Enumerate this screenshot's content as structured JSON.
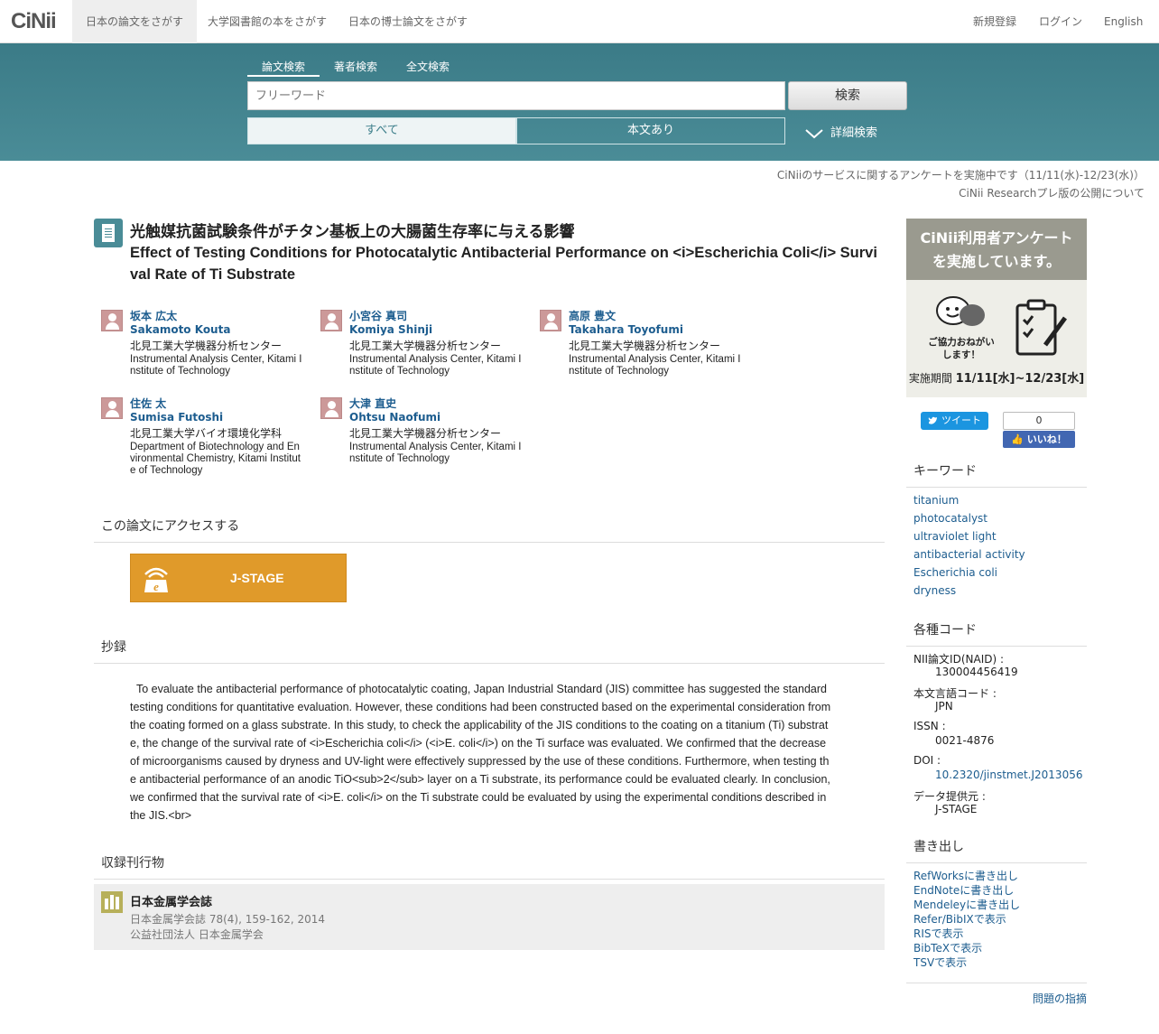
{
  "header": {
    "logo": "CiNii",
    "tabs": [
      "日本の論文をさがす",
      "大学図書館の本をさがす",
      "日本の博士論文をさがす"
    ],
    "right": [
      "新規登録",
      "ログイン",
      "English"
    ]
  },
  "search": {
    "tabs": [
      "論文検索",
      "著者検索",
      "全文検索"
    ],
    "placeholder": "フリーワード",
    "button": "検索",
    "filters": [
      "すべて",
      "本文あり"
    ],
    "advanced": "詳細検索"
  },
  "notices": [
    "CiNiiのサービスに関するアンケートを実施中です（11/11(水)-12/23(水)）",
    "CiNii Researchプレ版の公開について"
  ],
  "paper": {
    "title_ja": "光触媒抗菌試験条件がチタン基板上の大腸菌生存率に与える影響",
    "title_en": "Effect of Testing Conditions for Photocatalytic Antibacterial Performance on <i>Escherichia Coli</i> Survival Rate of Ti Substrate"
  },
  "authors": [
    {
      "ja": "坂本 広太",
      "en": "Sakamoto Kouta",
      "aff_ja": "北見工業大学機器分析センター",
      "aff_en": "Instrumental Analysis Center, Kitami Institute of Technology"
    },
    {
      "ja": "小宮谷 真司",
      "en": "Komiya Shinji",
      "aff_ja": "北見工業大学機器分析センター",
      "aff_en": "Instrumental Analysis Center, Kitami Institute of Technology"
    },
    {
      "ja": "高原 豊文",
      "en": "Takahara Toyofumi",
      "aff_ja": "北見工業大学機器分析センター",
      "aff_en": "Instrumental Analysis Center, Kitami Institute of Technology"
    },
    {
      "ja": "住佐 太",
      "en": "Sumisa Futoshi",
      "aff_ja": "北見工業大学バイオ環境化学科",
      "aff_en": "Department of Biotechnology and Environmental Chemistry, Kitami Institute of Technology"
    },
    {
      "ja": "大津 直史",
      "en": "Ohtsu Naofumi",
      "aff_ja": "北見工業大学機器分析センター",
      "aff_en": "Instrumental Analysis Center, Kitami Institute of Technology"
    }
  ],
  "access": {
    "heading": "この論文にアクセスする",
    "button": "J-STAGE"
  },
  "abstract": {
    "heading": "抄録",
    "text": "To evaluate the antibacterial performance of photocatalytic coating, Japan Industrial Standard (JIS) committee has suggested the standard testing conditions for quantitative evaluation. However, these conditions had been constructed based on the experimental consideration from the coating formed on a glass substrate. In this study, to check the applicability of the JIS conditions to the coating on a titanium (Ti) substrate, the change of the survival rate of <i>Escherichia coli</i> (<i>E. coli</i>) on the Ti surface was evaluated. We confirmed that the decrease of microorganisms caused by dryness and UV-light were effectively suppressed by the use of these conditions. Furthermore, when testing the antibacterial performance of an anodic TiO<sub>2</sub> layer on a Ti substrate, its performance could be evaluated clearly. In conclusion, we confirmed that the survival rate of <i>E. coli</i> on the Ti substrate could be evaluated by using the experimental conditions described in the JIS.<br>"
  },
  "journal": {
    "heading": "収録刊行物",
    "title": "日本金属学会誌",
    "citation": "日本金属学会誌 78(4), 159-162, 2014",
    "publisher": "公益社団法人 日本金属学会"
  },
  "sidebar": {
    "banner_line1": "CiNii利用者アンケート",
    "banner_line2": "を実施しています。",
    "banner_bubble": "ご協力おねがい",
    "banner_bubble2": "します！",
    "banner_period_label": "実施期間",
    "banner_period": "11/11[水]~12/23[水]",
    "tweet": "ツイート",
    "like_count": "0",
    "like": "いいね！",
    "keywords_heading": "キーワード",
    "keywords": [
      "titanium",
      "photocatalyst",
      "ultraviolet light",
      "antibacterial activity",
      "Escherichia coli",
      "dryness"
    ],
    "codes_heading": "各種コード",
    "codes": [
      {
        "k": "NII論文ID(NAID) :",
        "v": "130004456419"
      },
      {
        "k": "本文言語コード :",
        "v": "JPN"
      },
      {
        "k": "ISSN :",
        "v": "0021-4876"
      },
      {
        "k": "DOI :",
        "v": "10.2320/jinstmet.J2013056"
      },
      {
        "k": "データ提供元 :",
        "v": "J-STAGE"
      }
    ],
    "export_heading": "書き出し",
    "exports": [
      "RefWorksに書き出し",
      "EndNoteに書き出し",
      "Mendeleyに書き出し",
      "Refer/BibIXで表示",
      "RISで表示",
      "BibTeXで表示",
      "TSVで表示"
    ],
    "report": "問題の指摘"
  },
  "colors": {
    "teal": "#3e7f8b",
    "link": "#1d5d8f",
    "jstage": "#e09a2a"
  }
}
